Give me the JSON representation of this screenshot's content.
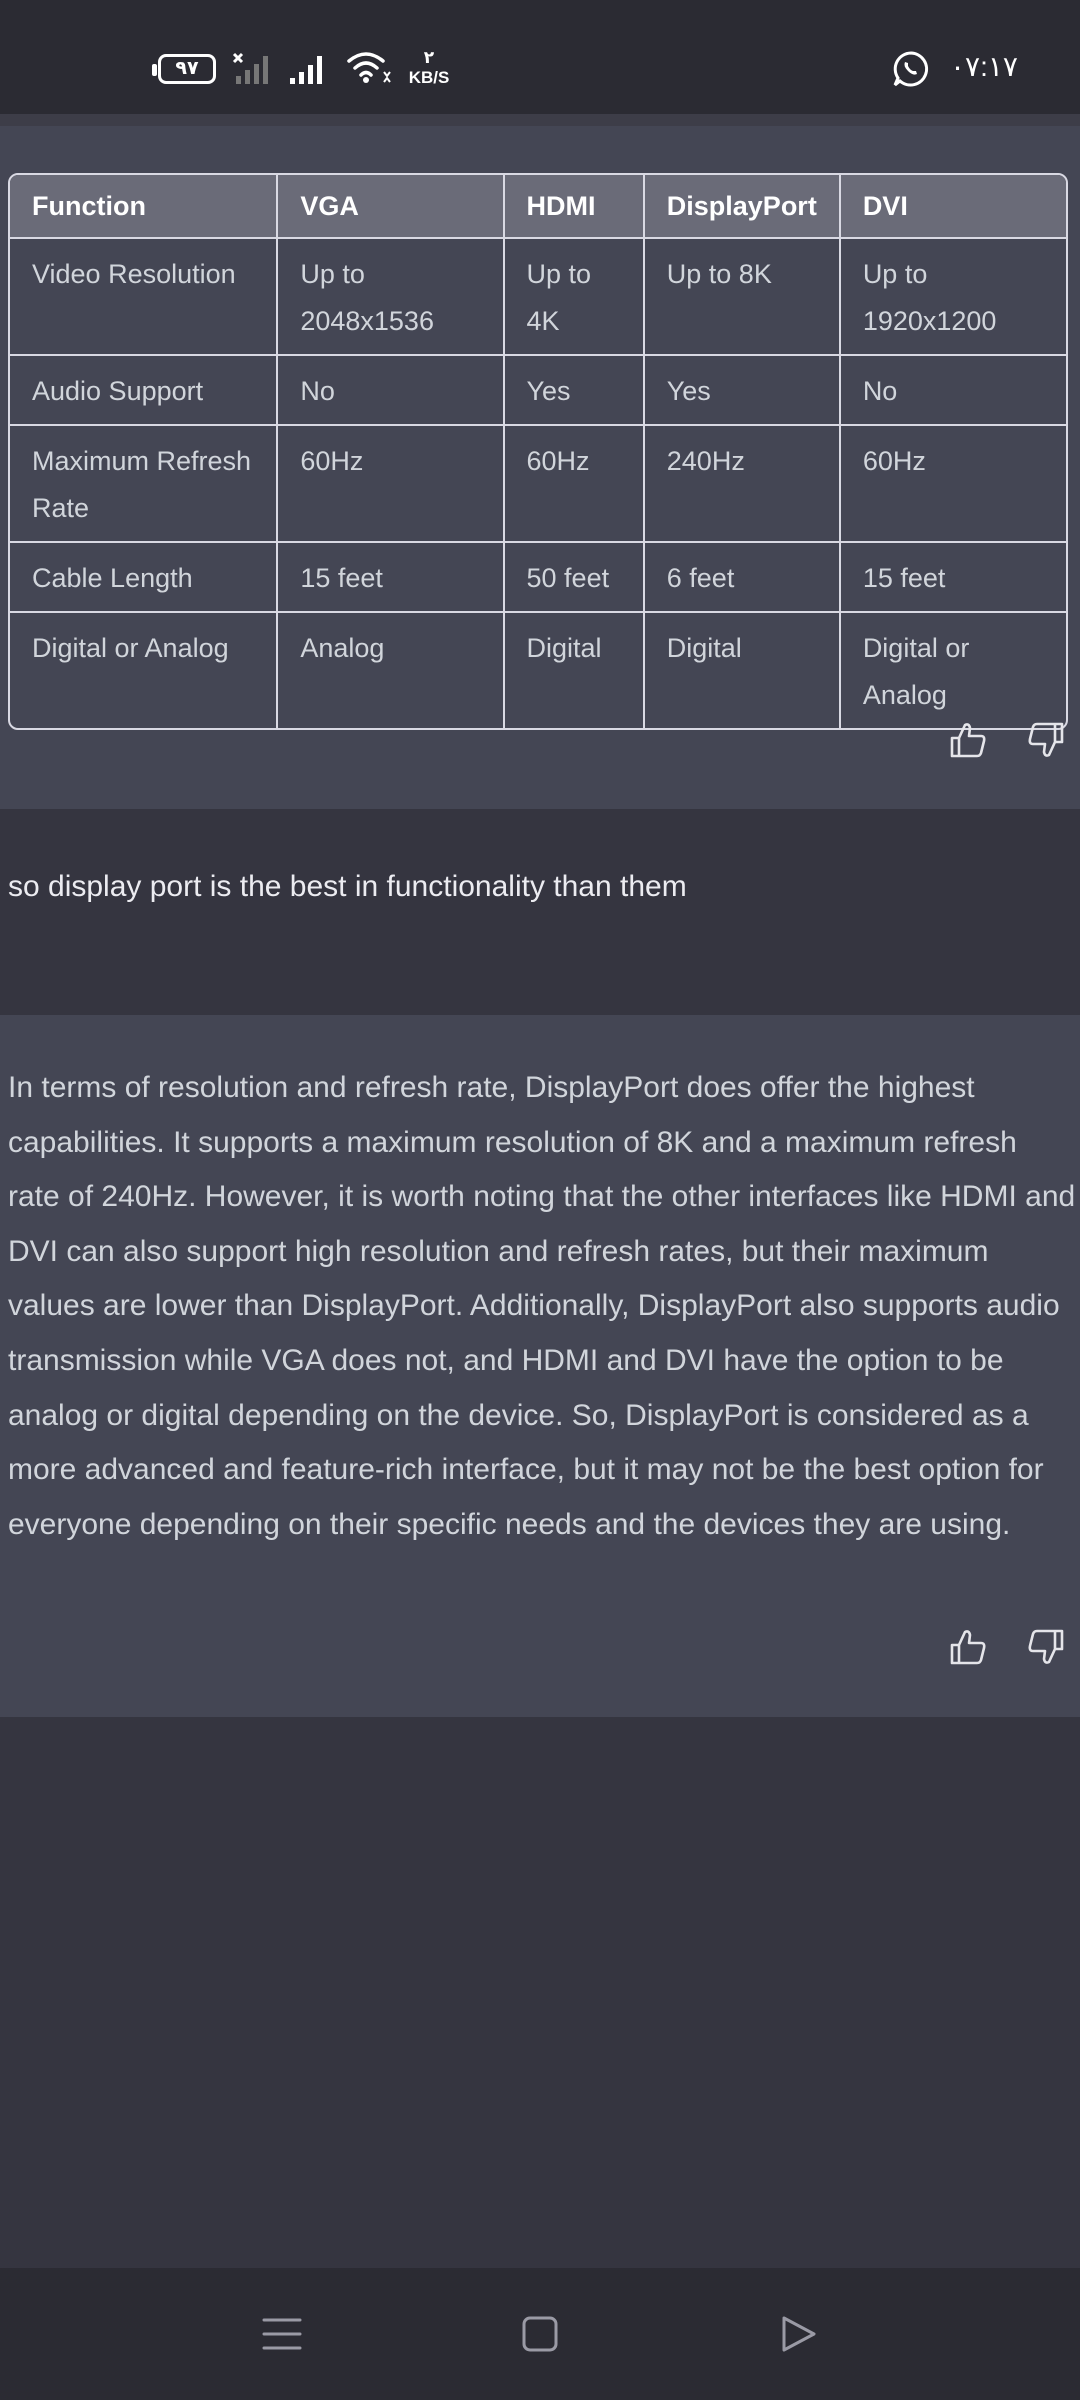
{
  "status_bar": {
    "battery_level": "٩٧",
    "net_speed_value": "٢",
    "net_speed_unit": "KB/S",
    "time": "٠٧:١٧",
    "icons": [
      "battery-icon",
      "no-signal-icon",
      "signal-icon",
      "wifi-icon",
      "whatsapp-icon"
    ]
  },
  "table": {
    "headers": [
      "Function",
      "VGA",
      "HDMI",
      "DisplayPort",
      "DVI"
    ],
    "rows": [
      [
        "Video Resolution",
        "Up to 2048x1536",
        "Up to 4K",
        "Up to 8K",
        "Up to 1920x1200"
      ],
      [
        "Audio Support",
        "No",
        "Yes",
        "Yes",
        "No"
      ],
      [
        "Maximum Refresh Rate",
        "60Hz",
        "60Hz",
        "240Hz",
        "60Hz"
      ],
      [
        "Cable Length",
        "15 feet",
        "50 feet",
        "6 feet",
        "15 feet"
      ],
      [
        "Digital or Analog",
        "Analog",
        "Digital",
        "Digital",
        "Digital or Analog"
      ]
    ]
  },
  "user_message": "so display port is the best in functionality than them",
  "assistant_message": "In terms of resolution and refresh rate, DisplayPort does offer the highest capabilities. It supports a maximum resolution of 8K and a maximum refresh rate of 240Hz. However, it is worth noting that the other interfaces like HDMI and DVI can also support high resolution and refresh rates, but their maximum values are lower than DisplayPort. Additionally, DisplayPort also supports audio transmission while VGA does not, and HDMI and DVI have the option to be analog or digital depending on the device. So, DisplayPort is considered as a more advanced and feature-rich interface, but it may not be the best option for everyone depending on their specific needs and the devices they are using.",
  "feedback_icons": [
    "thumbs-up-icon",
    "thumbs-down-icon"
  ],
  "nav_bar": {
    "icons": [
      "menu-icon",
      "home-icon",
      "back-icon"
    ]
  },
  "colors": {
    "status_bar_bg": "#2b2b33",
    "page_bg": "#353540",
    "assistant_bg": "#444654",
    "table_header_bg": "#6a6b78",
    "table_border": "#d9d9e3",
    "text_primary": "#ececf1",
    "text_secondary": "#d1d5db"
  }
}
